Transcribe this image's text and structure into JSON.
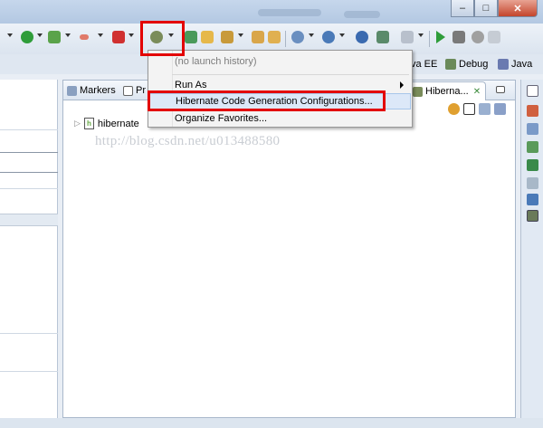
{
  "window": {
    "min_glyph": "–",
    "max_glyph": "□",
    "close_glyph": "✕"
  },
  "perspectives": {
    "java_ee": "va EE",
    "debug": "Debug",
    "java": "Java"
  },
  "views": {
    "markers": "Markers",
    "pr": "Pr",
    "hibernate_tab": "Hiberna...",
    "close_glyph": "✕"
  },
  "tree": {
    "item": "hibernate"
  },
  "watermark": "http://blog.csdn.net/u013488580",
  "menu": {
    "no_history": "(no launch history)",
    "run_as": "Run As",
    "hibernate_configs": "Hibernate Code Generation Configurations...",
    "organize_favorites": "Organize Favorites..."
  },
  "colors": {
    "highlight_box": "#e30000",
    "menu_selection": "#dce8f8"
  }
}
